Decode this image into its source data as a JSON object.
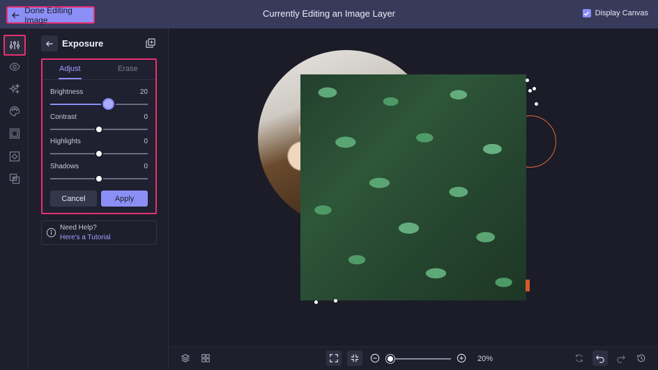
{
  "topbar": {
    "done_label": "Done Editing Image",
    "title": "Currently Editing an Image Layer",
    "display_canvas_label": "Display Canvas",
    "display_canvas_checked": true
  },
  "rail": {
    "items": [
      {
        "icon": "sliders-icon",
        "active": true
      },
      {
        "icon": "eye-icon",
        "active": false
      },
      {
        "icon": "sparkle-icon",
        "active": false
      },
      {
        "icon": "palette-icon",
        "active": false
      },
      {
        "icon": "frame-icon",
        "active": false
      },
      {
        "icon": "crop-icon",
        "active": false
      },
      {
        "icon": "layers-overlap-icon",
        "active": false
      }
    ]
  },
  "panel": {
    "title": "Exposure",
    "tabs": [
      {
        "label": "Adjust",
        "active": true
      },
      {
        "label": "Erase",
        "active": false
      }
    ],
    "sliders": [
      {
        "label": "Brightness",
        "value": "20",
        "fraction": 0.59
      },
      {
        "label": "Contrast",
        "value": "0",
        "fraction": 0.5
      },
      {
        "label": "Highlights",
        "value": "0",
        "fraction": 0.5
      },
      {
        "label": "Shadows",
        "value": "0",
        "fraction": 0.5
      }
    ],
    "cancel_label": "Cancel",
    "apply_label": "Apply",
    "help": {
      "title": "Need Help?",
      "link": "Here's a Tutorial"
    }
  },
  "bottombar": {
    "zoom_value": "20%",
    "zoom_fraction": 0.0
  },
  "colors": {
    "accent": "#8b8ff5",
    "highlight_border": "#e8306f",
    "topbar_bg": "#383a5c",
    "canvas_bg": "#1b1c27"
  }
}
